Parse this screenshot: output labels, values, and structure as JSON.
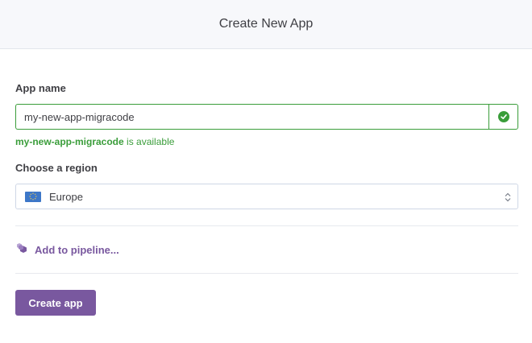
{
  "header": {
    "title": "Create New App"
  },
  "form": {
    "app_name_label": "App name",
    "app_name_value": "my-new-app-migracode",
    "availability_name": "my-new-app-migracode",
    "availability_suffix": " is available",
    "region_label": "Choose a region",
    "region_value": "Europe",
    "pipeline_label": "Add to pipeline...",
    "create_button_label": "Create app"
  },
  "colors": {
    "success": "#3a9d3a",
    "accent": "#79589f",
    "flag_blue": "#3d77c8",
    "flag_star": "#f2c94c"
  },
  "icons": {
    "status": "check-circle-icon",
    "region_flag": "eu-flag-icon",
    "select": "chevron-up-down-icon",
    "pipeline": "pipeline-icon"
  }
}
